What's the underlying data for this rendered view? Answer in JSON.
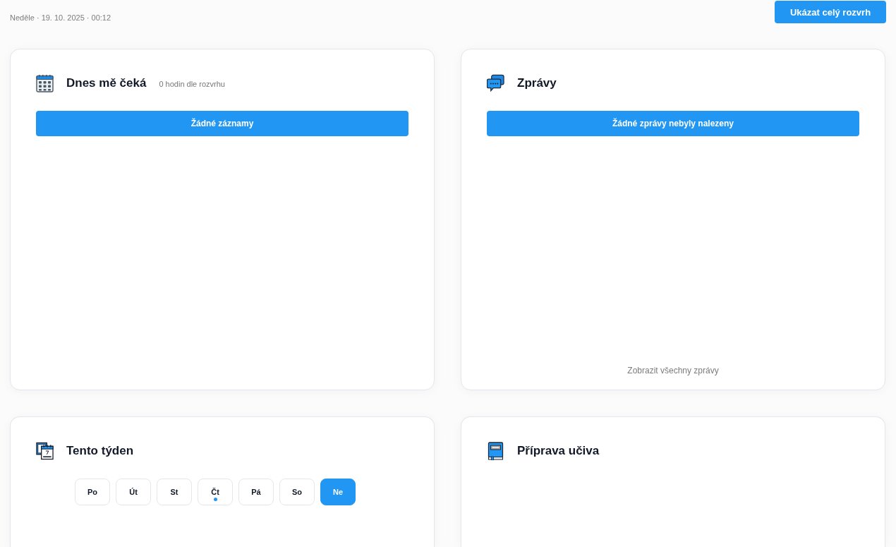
{
  "header": {
    "date": "Neděle · 19. 10. 2025 · 00:12",
    "action_button": "Ukázat celý rozvrh"
  },
  "cards": [
    {
      "kind": "today",
      "title": "Dnes mě čeká",
      "subtitle": "0 hodin dle rozvrhu",
      "empty_message": "Žádné záznamy"
    },
    {
      "kind": "messages",
      "title": "Zprávy",
      "empty_message": "Žádné zprávy nebyly nalezeny",
      "footer_link": "Zobrazit všechny zprávy"
    },
    {
      "kind": "week",
      "title": "Tento týden",
      "days": [
        {
          "label": "Po",
          "selected": false,
          "marked": false
        },
        {
          "label": "Út",
          "selected": false,
          "marked": false
        },
        {
          "label": "St",
          "selected": false,
          "marked": false
        },
        {
          "label": "Čt",
          "selected": false,
          "marked": true
        },
        {
          "label": "Pá",
          "selected": false,
          "marked": false
        },
        {
          "label": "So",
          "selected": false,
          "marked": false
        },
        {
          "label": "Ne",
          "selected": true,
          "marked": false
        }
      ]
    },
    {
      "kind": "lesson_prep",
      "title": "Příprava učiva"
    }
  ]
}
